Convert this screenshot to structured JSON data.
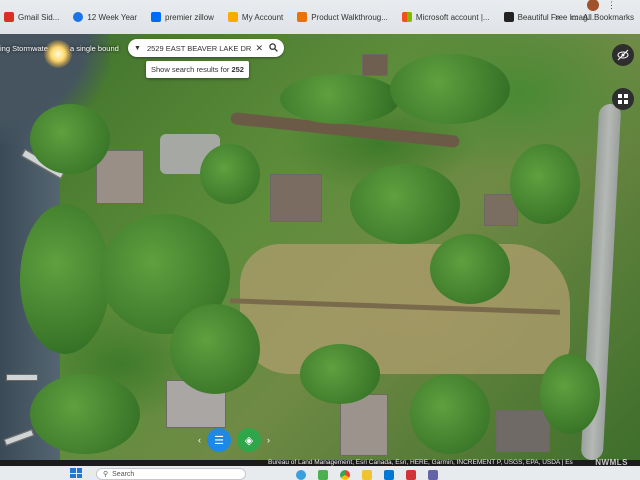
{
  "bookmarks": [
    {
      "label": "Gmail Sid...",
      "color": "#d93025"
    },
    {
      "label": "12 Week Year",
      "color": "#1a73e8"
    },
    {
      "label": "premier zillow",
      "color": "#006aff"
    },
    {
      "label": "My Account",
      "color": "#f9ab00"
    },
    {
      "label": "Product Walkthroug...",
      "color": "#e8710a"
    },
    {
      "label": "Microsoft account |...",
      "color": "#00a4ef"
    },
    {
      "label": "Beautiful Free Imag...",
      "color": "#000000"
    }
  ],
  "all_bookmarks_label": "All Bookmarks",
  "search": {
    "value": "2529 EAST BEAVER LAKE DR",
    "suggestion_prefix": "Show search results for ",
    "suggestion_query": "252"
  },
  "left_overlay": {
    "text1": "ing Stormwate",
    "text2": "a single bound"
  },
  "attribution": "Bureau of Land Management, Esri Canada, Esri, HERE, Garmin, INCREMENT P, USGS, EPA, USDA | Es",
  "watermark": "NWMLS",
  "taskbar": {
    "search_placeholder": "Search"
  },
  "icons": {
    "search": "search-icon",
    "clear": "close-icon",
    "dropdown": "chevron-down-icon",
    "eye": "eye-icon",
    "basemap": "grid-icon",
    "list": "list-icon",
    "layers": "layers-icon"
  }
}
